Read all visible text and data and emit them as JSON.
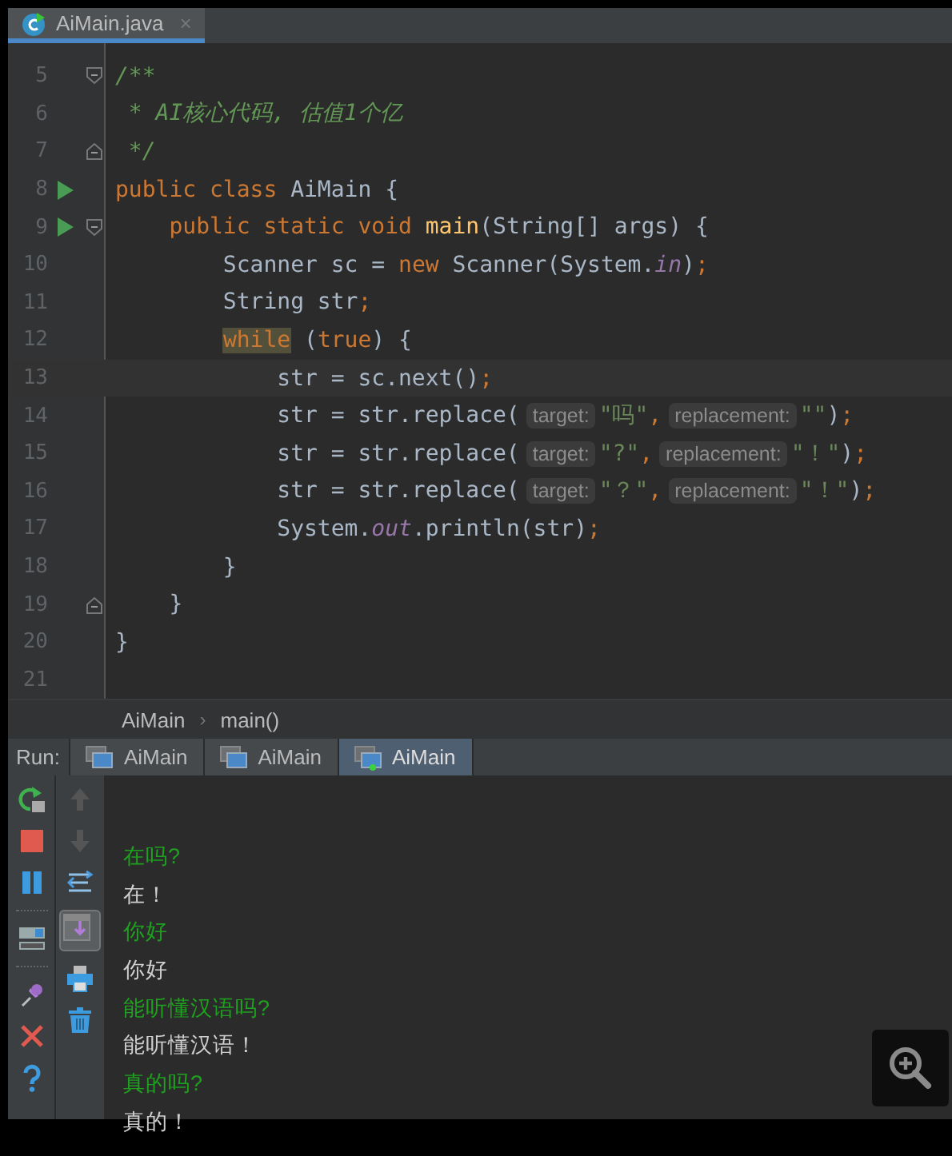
{
  "editor_tab": {
    "title": "AiMain.java",
    "close": "×",
    "selected": true
  },
  "code_lines": [
    {
      "number": "5",
      "run_marker": false,
      "fold_start": true,
      "fold_end": false,
      "current": false,
      "tokens": [
        {
          "kind": "comment",
          "text": "/**"
        }
      ]
    },
    {
      "number": "6",
      "run_marker": false,
      "fold_start": false,
      "fold_end": false,
      "current": false,
      "tokens": [
        {
          "kind": "comment",
          "text": " * AI核心代码, 估值1个亿"
        }
      ]
    },
    {
      "number": "7",
      "run_marker": false,
      "fold_start": false,
      "fold_end": true,
      "current": false,
      "tokens": [
        {
          "kind": "comment",
          "text": " */"
        }
      ]
    },
    {
      "number": "8",
      "run_marker": true,
      "fold_start": false,
      "fold_end": false,
      "current": false,
      "tokens": [
        {
          "kind": "keyword",
          "text": "public class "
        },
        {
          "kind": "plain",
          "text": "AiMain {"
        }
      ]
    },
    {
      "number": "9",
      "run_marker": true,
      "fold_start": true,
      "fold_end": false,
      "current": false,
      "tokens": [
        {
          "kind": "keyword",
          "text": "    public static void "
        },
        {
          "kind": "method",
          "text": "main"
        },
        {
          "kind": "plain",
          "text": "(String[] args) {"
        }
      ]
    },
    {
      "number": "10",
      "run_marker": false,
      "fold_start": false,
      "fold_end": false,
      "current": false,
      "tokens": [
        {
          "kind": "plain",
          "text": "        Scanner sc = "
        },
        {
          "kind": "keyword",
          "text": "new "
        },
        {
          "kind": "plain",
          "text": "Scanner(System."
        },
        {
          "kind": "field",
          "text": "in"
        },
        {
          "kind": "plain",
          "text": ")"
        },
        {
          "kind": "keyword",
          "text": ";"
        }
      ]
    },
    {
      "number": "11",
      "run_marker": false,
      "fold_start": false,
      "fold_end": false,
      "current": false,
      "tokens": [
        {
          "kind": "plain",
          "text": "        String str"
        },
        {
          "kind": "keyword",
          "text": ";"
        }
      ]
    },
    {
      "number": "12",
      "run_marker": false,
      "fold_start": false,
      "fold_end": false,
      "current": false,
      "tokens": [
        {
          "kind": "keyword",
          "text": "        while",
          "highlighted": true
        },
        {
          "kind": "plain",
          "text": " ("
        },
        {
          "kind": "keyword",
          "text": "true"
        },
        {
          "kind": "plain",
          "text": ") {"
        }
      ]
    },
    {
      "number": "13",
      "run_marker": false,
      "fold_start": false,
      "fold_end": false,
      "current": true,
      "tokens": [
        {
          "kind": "plain",
          "text": "            str = sc.next()"
        },
        {
          "kind": "keyword",
          "text": ";"
        }
      ]
    },
    {
      "number": "14",
      "run_marker": false,
      "fold_start": false,
      "fold_end": false,
      "current": false,
      "tokens": [
        {
          "kind": "plain",
          "text": "            str = str.replace("
        },
        {
          "kind": "hint",
          "text": "target:"
        },
        {
          "kind": "string",
          "text": "\"吗\""
        },
        {
          "kind": "keyword",
          "text": ","
        },
        {
          "kind": "hint",
          "text": "replacement:"
        },
        {
          "kind": "string",
          "text": "\"\""
        },
        {
          "kind": "plain",
          "text": ")"
        },
        {
          "kind": "keyword",
          "text": ";"
        }
      ]
    },
    {
      "number": "15",
      "run_marker": false,
      "fold_start": false,
      "fold_end": false,
      "current": false,
      "tokens": [
        {
          "kind": "plain",
          "text": "            str = str.replace("
        },
        {
          "kind": "hint",
          "text": "target:"
        },
        {
          "kind": "string",
          "text": "\"?\""
        },
        {
          "kind": "keyword",
          "text": ","
        },
        {
          "kind": "hint",
          "text": "replacement:"
        },
        {
          "kind": "string",
          "text": "\"！\""
        },
        {
          "kind": "plain",
          "text": ")"
        },
        {
          "kind": "keyword",
          "text": ";"
        }
      ]
    },
    {
      "number": "16",
      "run_marker": false,
      "fold_start": false,
      "fold_end": false,
      "current": false,
      "tokens": [
        {
          "kind": "plain",
          "text": "            str = str.replace("
        },
        {
          "kind": "hint",
          "text": "target:"
        },
        {
          "kind": "string",
          "text": "\"？\""
        },
        {
          "kind": "keyword",
          "text": ","
        },
        {
          "kind": "hint",
          "text": "replacement:"
        },
        {
          "kind": "string",
          "text": "\"！\""
        },
        {
          "kind": "plain",
          "text": ")"
        },
        {
          "kind": "keyword",
          "text": ";"
        }
      ]
    },
    {
      "number": "17",
      "run_marker": false,
      "fold_start": false,
      "fold_end": false,
      "current": false,
      "tokens": [
        {
          "kind": "plain",
          "text": "            System."
        },
        {
          "kind": "field",
          "text": "out"
        },
        {
          "kind": "plain",
          "text": ".println(str)"
        },
        {
          "kind": "keyword",
          "text": ";"
        }
      ]
    },
    {
      "number": "18",
      "run_marker": false,
      "fold_start": false,
      "fold_end": false,
      "current": false,
      "tokens": [
        {
          "kind": "plain",
          "text": "        }"
        }
      ]
    },
    {
      "number": "19",
      "run_marker": false,
      "fold_start": false,
      "fold_end": true,
      "current": false,
      "tokens": [
        {
          "kind": "plain",
          "text": "    }"
        }
      ]
    },
    {
      "number": "20",
      "run_marker": false,
      "fold_start": false,
      "fold_end": false,
      "current": false,
      "tokens": [
        {
          "kind": "plain",
          "text": "}"
        }
      ]
    },
    {
      "number": "21",
      "run_marker": false,
      "fold_start": false,
      "fold_end": false,
      "current": false
    }
  ],
  "breadcrumbs": {
    "items": [
      "AiMain",
      "main()"
    ],
    "separator": "›"
  },
  "run_panel": {
    "label": "Run:",
    "tabs": [
      {
        "label": "AiMain",
        "selected": false,
        "running": false
      },
      {
        "label": "AiMain",
        "selected": false,
        "running": false
      },
      {
        "label": "AiMain",
        "selected": true,
        "running": true
      }
    ]
  },
  "console": [
    {
      "kind": "input",
      "text": "在吗?"
    },
    {
      "kind": "output",
      "text": "在！"
    },
    {
      "kind": "input",
      "text": "你好"
    },
    {
      "kind": "output",
      "text": "你好"
    },
    {
      "kind": "input",
      "text": "能听懂汉语吗?"
    },
    {
      "kind": "output",
      "text": "能听懂汉语！"
    },
    {
      "kind": "input",
      "text": "真的吗?"
    },
    {
      "kind": "output",
      "text": "真的！"
    }
  ]
}
